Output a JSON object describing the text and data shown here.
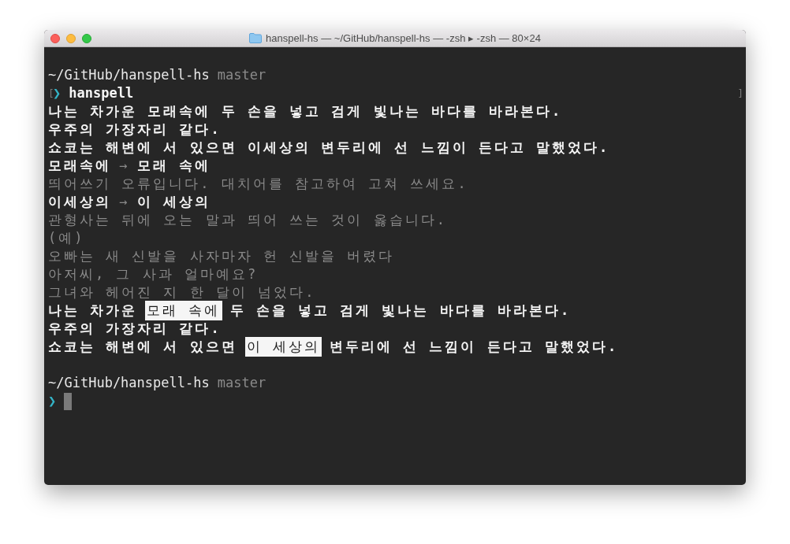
{
  "window": {
    "title": "hanspell-hs — ~/GitHub/hanspell-hs — -zsh ▸ -zsh — 80×24"
  },
  "lines": [
    {
      "kind": "blank"
    },
    {
      "kind": "path",
      "path": "~/GitHub/hanspell-hs",
      "branch": "master"
    },
    {
      "kind": "command",
      "mark_open": "[",
      "prompt": "❯",
      "command": "hanspell",
      "mark_close": "]"
    },
    {
      "kind": "text",
      "segments": [
        {
          "text": "나는 차가운 모래속에 두 손을 넣고 검게 빛나는 바다를 바라본다.",
          "kind": "bright"
        }
      ]
    },
    {
      "kind": "text",
      "segments": [
        {
          "text": "우주의 가장자리 같다.",
          "kind": "bright"
        }
      ]
    },
    {
      "kind": "text",
      "segments": [
        {
          "text": "쇼코는 해변에 서 있으면 이세상의 변두리에 선 느낌이 든다고 말했었다.",
          "kind": "bright"
        }
      ]
    },
    {
      "kind": "text",
      "segments": [
        {
          "text": "모래속에",
          "kind": "bright"
        },
        {
          "text": "→",
          "kind": "dim"
        },
        {
          "text": "모래 속에",
          "kind": "bright"
        }
      ]
    },
    {
      "kind": "text",
      "segments": [
        {
          "text": "띄어쓰기 오류입니다. 대치어를 참고하여 고쳐 쓰세요.",
          "kind": "dim"
        }
      ]
    },
    {
      "kind": "text",
      "segments": [
        {
          "text": "이세상의",
          "kind": "bright"
        },
        {
          "text": "→",
          "kind": "dim"
        },
        {
          "text": "이 세상의",
          "kind": "bright"
        }
      ]
    },
    {
      "kind": "text",
      "segments": [
        {
          "text": "관형사는 뒤에 오는 말과 띄어 쓰는 것이 옳습니다.",
          "kind": "dim"
        }
      ]
    },
    {
      "kind": "text",
      "segments": [
        {
          "text": "(예)",
          "kind": "dim"
        }
      ]
    },
    {
      "kind": "text",
      "segments": [
        {
          "text": "오빠는 새 신발을 사자마자 헌 신발을 버렸다",
          "kind": "dim"
        }
      ]
    },
    {
      "kind": "text",
      "segments": [
        {
          "text": "아저씨, 그 사과 얼마예요?",
          "kind": "dim"
        }
      ]
    },
    {
      "kind": "text",
      "segments": [
        {
          "text": "그녀와 헤어진 지 한 달이 넘었다.",
          "kind": "dim"
        }
      ]
    },
    {
      "kind": "text",
      "segments": [
        {
          "text": "나는 차가운",
          "kind": "bright"
        },
        {
          "text": "모래 속에",
          "kind": "highlight"
        },
        {
          "text": "두 손을 넣고 검게 빛나는 바다를 바라본다.",
          "kind": "bright"
        }
      ]
    },
    {
      "kind": "text",
      "segments": [
        {
          "text": "우주의 가장자리 같다.",
          "kind": "bright"
        }
      ]
    },
    {
      "kind": "text",
      "segments": [
        {
          "text": "쇼코는 해변에 서 있으면",
          "kind": "bright"
        },
        {
          "text": "이 세상의",
          "kind": "highlight"
        },
        {
          "text": "변두리에 선 느낌이 든다고 말했었다.",
          "kind": "bright"
        }
      ]
    },
    {
      "kind": "blank"
    },
    {
      "kind": "path",
      "path": "~/GitHub/hanspell-hs",
      "branch": "master"
    },
    {
      "kind": "cursor",
      "prompt": "❯"
    }
  ]
}
